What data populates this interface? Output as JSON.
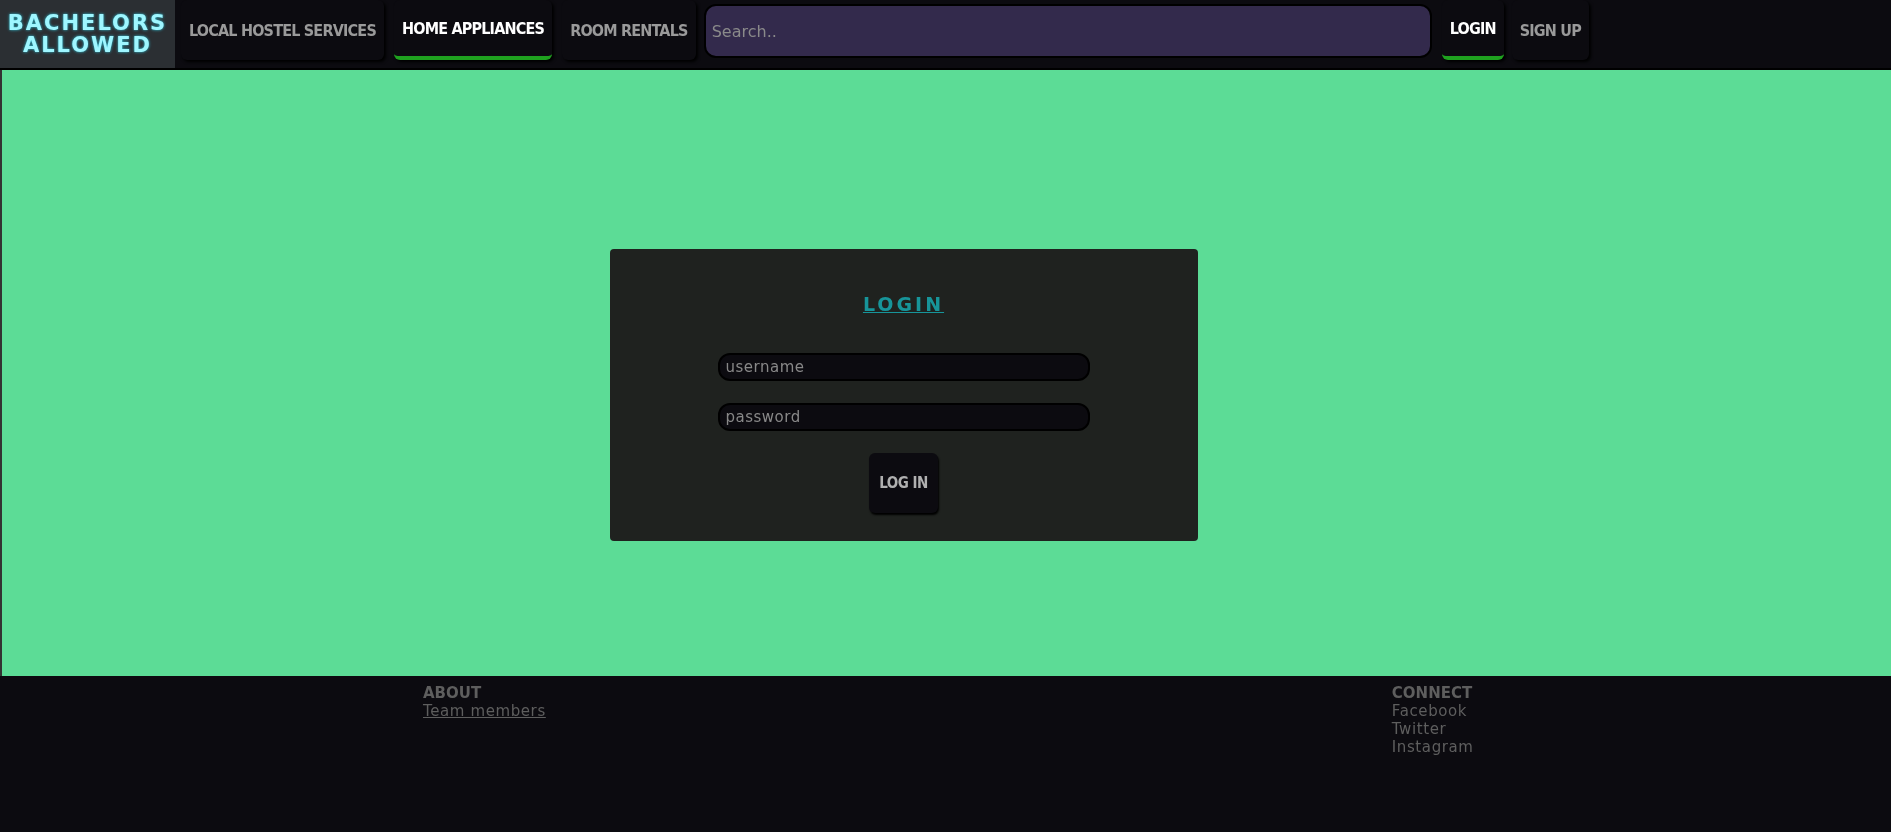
{
  "logo": {
    "lines": [
      "BACHELORS",
      "ALLOWED"
    ]
  },
  "nav": {
    "items": [
      {
        "label": "LOCAL HOSTEL SERVICES",
        "selected": false
      },
      {
        "label": "HOME APPLIANCES",
        "selected": true
      },
      {
        "label": "ROOM RENTALS",
        "selected": false
      }
    ],
    "search": {
      "placeholder": "Search.."
    },
    "account": [
      {
        "label": "LOGIN",
        "selected": true
      },
      {
        "label": "SIGN UP",
        "selected": false
      }
    ]
  },
  "login_form": {
    "title": "LOGIN",
    "fields": [
      {
        "placeholder": "username"
      },
      {
        "placeholder": "password"
      }
    ],
    "submit": "LOG IN"
  },
  "footer": {
    "columns": [
      {
        "heading": "ABOUT",
        "links": [
          {
            "label": "Team members",
            "underlined": true
          }
        ]
      },
      {
        "heading": "CONNECT",
        "links": [
          {
            "label": "Facebook",
            "underlined": false
          },
          {
            "label": "Twitter",
            "underlined": false
          },
          {
            "label": "Instagram",
            "underlined": false
          }
        ]
      }
    ]
  }
}
